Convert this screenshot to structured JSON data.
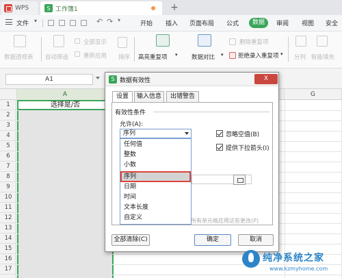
{
  "tabs": {
    "app": "WPS",
    "doc": "工作簿1",
    "new": "+"
  },
  "menu": {
    "file": "文件",
    "items": [
      "开始",
      "插入",
      "页面布局",
      "公式",
      "数据",
      "审阅",
      "视图",
      "安全"
    ]
  },
  "ribbon": [
    {
      "label": "数据透视表",
      "enabled": false
    },
    {
      "label": "自动筛选",
      "enabled": false
    },
    {
      "label": "全部显示",
      "enabled": false
    },
    {
      "label": "重新应用",
      "enabled": false
    },
    {
      "label": "排序",
      "enabled": false
    },
    {
      "label": "高亮重复项",
      "enabled": true
    },
    {
      "label": "数据对比",
      "enabled": true
    },
    {
      "label": "删除重复项",
      "enabled": false
    },
    {
      "label": "拒绝录入重复项",
      "enabled": true
    },
    {
      "label": "分列",
      "enabled": false
    },
    {
      "label": "智能填充",
      "enabled": false
    }
  ],
  "formula_bar": {
    "name_box": "A1"
  },
  "sheet": {
    "columns": [
      "A",
      "G"
    ],
    "rows": [
      "1",
      "2",
      "3",
      "4",
      "5",
      "6",
      "7",
      "8",
      "9",
      "10",
      "11",
      "12",
      "13",
      "14",
      "15",
      "16",
      "17"
    ],
    "a1_value": "选择是/否"
  },
  "dialog": {
    "title": "数据有效性",
    "close": "X",
    "tabs": [
      "设置",
      "输入信息",
      "出错警告"
    ],
    "conditions_label": "有效性条件",
    "allow_label": "允许(A):",
    "allow_value": "序列",
    "ignore_blank": "忽略空值(B)",
    "dropdown_arrow": "提供下拉箭头(I)",
    "options": [
      "任何值",
      "整数",
      "小数",
      "序列",
      "日期",
      "时间",
      "文本长度",
      "自定义"
    ],
    "selected_option": "序列",
    "apply_text": "所有单元格应用这些更改(P)",
    "clear_all": "全部清除(C)",
    "ok": "确定",
    "cancel": "取消"
  },
  "watermark": {
    "title": "纯净系统之家",
    "url": "www.kzmyhome.com"
  },
  "colors": {
    "accent": "#3aa65a",
    "highlight": "#d9453a",
    "watermark": "#2c85c9"
  }
}
